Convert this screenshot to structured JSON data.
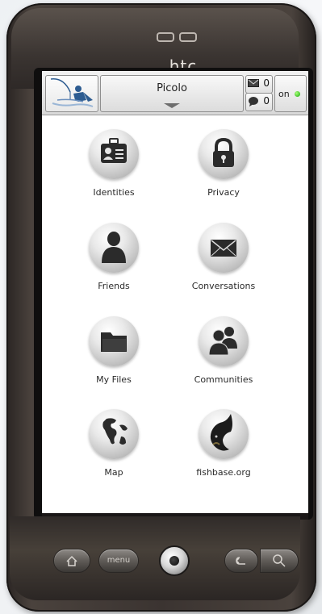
{
  "device": {
    "brand": "htc"
  },
  "topbar": {
    "title": "Picolo",
    "messages_count": "0",
    "comments_count": "0",
    "status_label": "on",
    "status_color": "#15a80a"
  },
  "grid": {
    "items": [
      {
        "label": "Identities",
        "icon": "id-card-icon"
      },
      {
        "label": "Privacy",
        "icon": "lock-icon"
      },
      {
        "label": "Friends",
        "icon": "person-icon"
      },
      {
        "label": "Conversations",
        "icon": "envelope-icon"
      },
      {
        "label": "My Files",
        "icon": "folder-icon"
      },
      {
        "label": "Communities",
        "icon": "people-icon"
      },
      {
        "label": "Map",
        "icon": "globe-icon"
      },
      {
        "label": "fishbase.org",
        "icon": "fish-icon"
      }
    ]
  },
  "hardware_buttons": {
    "menu_label": "menu"
  }
}
